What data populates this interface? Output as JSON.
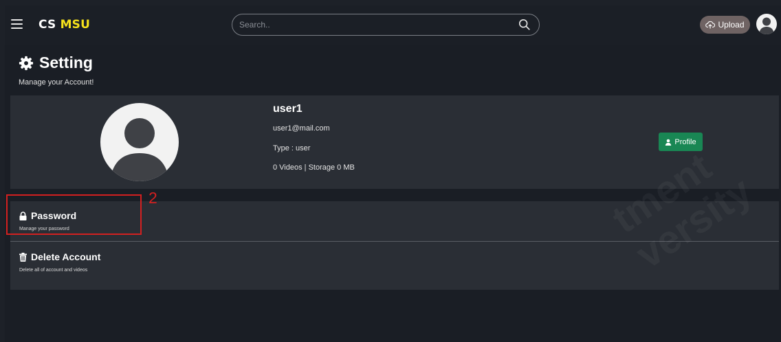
{
  "header": {
    "brand_left": "CS",
    "brand_right": "MSU",
    "search_placeholder": "Search..",
    "upload_label": "Upload"
  },
  "page": {
    "title": "Setting",
    "subtitle": "Manage your Account!"
  },
  "profile": {
    "username": "user1",
    "email": "user1@mail.com",
    "type_line": "Type : user",
    "stats_line": "0 Videos | Storage 0 MB",
    "profile_button": "Profile"
  },
  "settings": {
    "items": [
      {
        "title": "Password",
        "description": "Manage your password"
      },
      {
        "title": "Delete Account",
        "description": "Delete all of account and videos"
      }
    ]
  },
  "annotation": {
    "number": "2"
  },
  "watermark": {
    "line1": "tment",
    "line2": "versity"
  },
  "icons": {
    "menu": "hamburger-icon",
    "search": "search-icon",
    "upload": "cloud-upload-icon",
    "avatar": "user-avatar-icon",
    "settings": "gear-icon",
    "profile": "user-icon",
    "password": "lock-icon",
    "delete": "trash-icon"
  },
  "colors": {
    "background": "#1d2128",
    "card": "#2a2e35",
    "brand_accent": "#f5e11c",
    "profile_button": "#198754",
    "upload_button": "#6f6363",
    "annotation": "#d42020"
  }
}
